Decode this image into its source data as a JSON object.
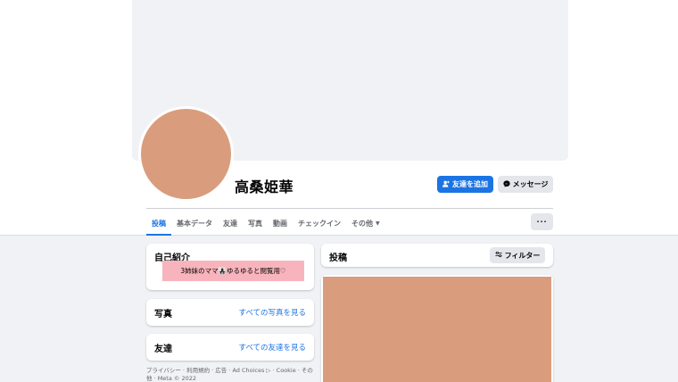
{
  "profile": {
    "name": "高桑姫華",
    "add_friend_label": "友達を追加",
    "add_friend_icon": "person-add-icon",
    "message_label": "メッセージ",
    "message_icon": "messenger-icon",
    "avatar_color": "#d99d7e"
  },
  "tabs": [
    {
      "label": "投稿",
      "active": true
    },
    {
      "label": "基本データ"
    },
    {
      "label": "友達"
    },
    {
      "label": "写真"
    },
    {
      "label": "動画"
    },
    {
      "label": "チェックイン"
    },
    {
      "label": "その他",
      "caret": "▼"
    }
  ],
  "more_button": "···",
  "intro": {
    "title": "自己紹介",
    "bio": "3姉妹のママ👩‍👧‍👧ゆるゆると閲覧用♡"
  },
  "photos": {
    "title": "写真",
    "see_all": "すべての写真を見る"
  },
  "friends": {
    "title": "友達",
    "see_all": "すべての友達を見る"
  },
  "footer": {
    "text": "プライバシー · 利用規約 · 広告 · Ad Choices ▷ · Cookie · その他 · Meta © 2022"
  },
  "posts": {
    "title": "投稿",
    "filter_label": "フィルター",
    "filter_icon": "sliders-icon"
  },
  "colors": {
    "accent": "#1b74e4",
    "bio_highlight": "#f8b4bc",
    "image_placeholder": "#d99d7e"
  }
}
